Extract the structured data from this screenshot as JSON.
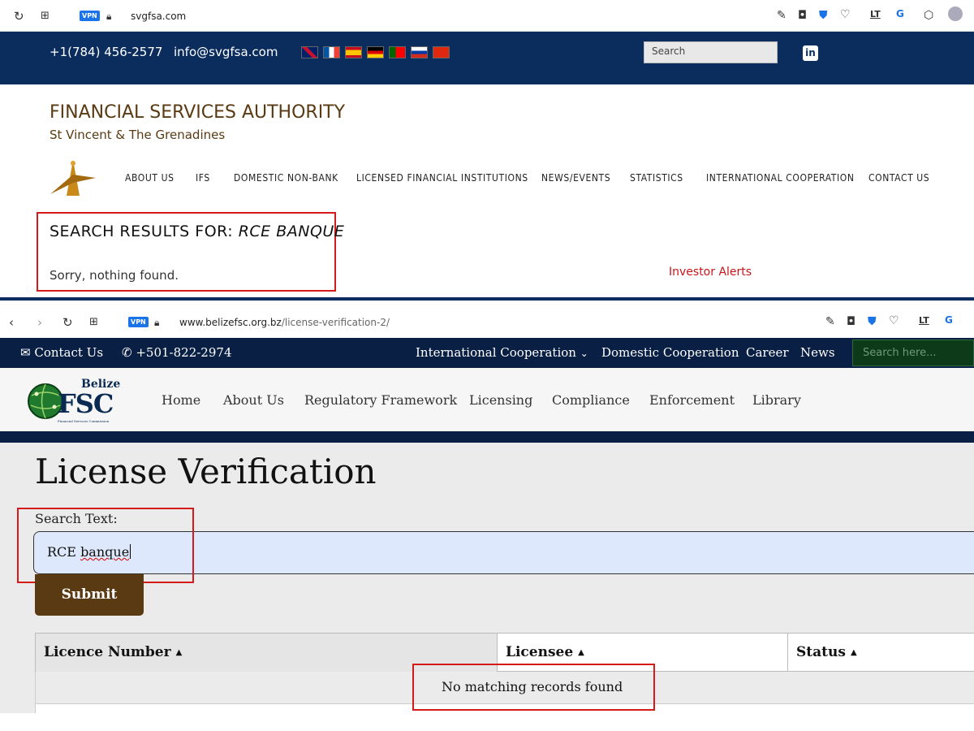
{
  "top_browser": {
    "url": "svgfsa.com",
    "vpn_label": "VPN"
  },
  "svgfsa": {
    "phone": "+1(784) 456-2577",
    "email": "info@svgfsa.com",
    "search_placeholder": "Search",
    "linkedin_label": "in",
    "title": "FINANCIAL SERVICES AUTHORITY",
    "subtitle": "St Vincent & The Grenadines",
    "nav": [
      "ABOUT US",
      "IFS",
      "DOMESTIC NON-BANK",
      "LICENSED FINANCIAL INSTITUTIONS",
      "NEWS/EVENTS",
      "STATISTICS",
      "INTERNATIONAL COOPERATION",
      "CONTACT US"
    ],
    "search_heading_prefix": "SEARCH RESULTS FOR:",
    "search_heading_query": "RCE BANQUE",
    "no_results": "Sorry, nothing found.",
    "investor_alerts": "Investor Alerts"
  },
  "bottom_browser": {
    "url_domain": "www.belizefsc.org.bz",
    "url_path": "/license-verification-2/",
    "vpn_label": "VPN"
  },
  "belize": {
    "contact": "Contact Us",
    "phone": "+501-822-2974",
    "top_links": [
      "International Cooperation",
      "Domestic Cooperation",
      "Career",
      "News"
    ],
    "search_placeholder": "Search here...",
    "logo_top": "Belize",
    "logo_main": "FSC",
    "logo_sub": "Financial Services Commission",
    "nav": [
      "Home",
      "About Us",
      "Regulatory Framework",
      "Licensing",
      "Compliance",
      "Enforcement",
      "Library"
    ],
    "page_title": "License Verification",
    "search_label": "Search Text:",
    "search_value_word1": "RCE",
    "search_value_word2": "banque",
    "submit": "Submit",
    "columns": [
      "Licence Number",
      "Licensee",
      "Status"
    ],
    "no_records": "No matching records found"
  }
}
